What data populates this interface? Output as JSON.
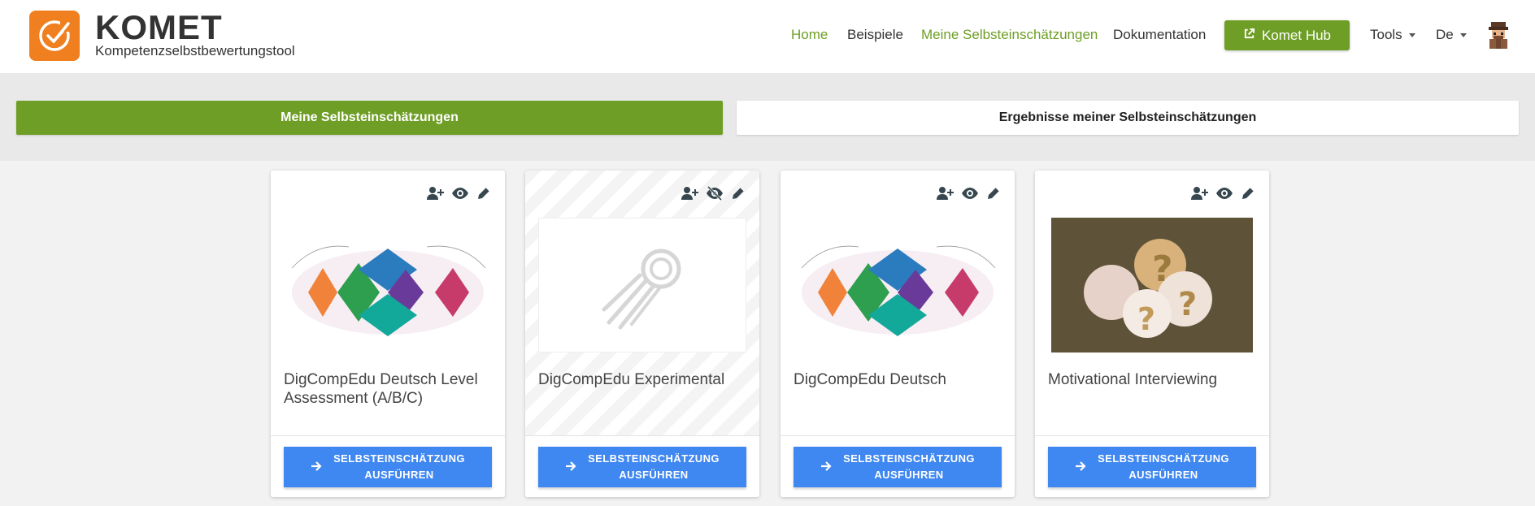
{
  "header": {
    "logo_title": "KOMET",
    "logo_subtitle": "Kompetenzselbstbewertungstool",
    "logo_icon": "check-circle-icon",
    "nav": {
      "home": "Home",
      "examples": "Beispiele",
      "my_assessments": "Meine Selbsteinschätzungen",
      "docs": "Dokumentation",
      "hub": "Komet Hub",
      "tools": "Tools",
      "language": "De"
    },
    "colors": {
      "brand_orange": "#f07f1f",
      "accent_green": "#6e9e26",
      "button_blue": "#3f87f1"
    }
  },
  "tabs": {
    "active": "Meine Selbsteinschätzungen",
    "inactive": "Ergebnisse meiner Selbsteinschätzungen"
  },
  "cards": [
    {
      "title": "DigCompEdu Deutsch Level Assessment (A/B/C)",
      "visibility": "visible",
      "image": "digcompedu-diagram",
      "button_line1": "SELBSTEINSCHÄTZUNG",
      "button_line2": "AUSFÜHREN"
    },
    {
      "title": "DigCompEdu Experimental",
      "visibility": "hidden",
      "image": "placeholder-comet",
      "button_line1": "SELBSTEINSCHÄTZUNG",
      "button_line2": "AUSFÜHREN"
    },
    {
      "title": "DigCompEdu Deutsch",
      "visibility": "visible",
      "image": "digcompedu-diagram",
      "button_line1": "SELBSTEINSCHÄTZUNG",
      "button_line2": "AUSFÜHREN"
    },
    {
      "title": "Motivational Interviewing",
      "visibility": "visible",
      "image": "question-marks-photo",
      "button_line1": "SELBSTEINSCHÄTZUNG",
      "button_line2": "AUSFÜHREN"
    }
  ]
}
